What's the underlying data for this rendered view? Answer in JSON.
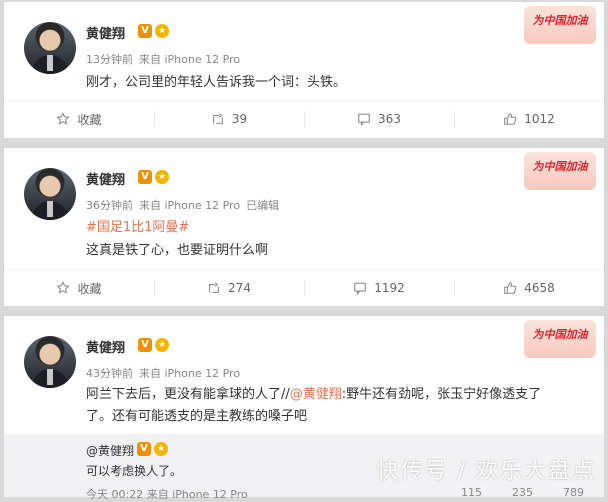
{
  "posts": [
    {
      "user": "黄健翔",
      "time": "13分钟前",
      "from": "来自 iPhone 12 Pro",
      "text": "刚才，公司里的年轻人告诉我一个词：头铁。",
      "favorite_label": "收藏",
      "reposts": "39",
      "comments": "363",
      "likes": "1012",
      "sticker": "为中国加油"
    },
    {
      "user": "黄健翔",
      "time": "36分钟前",
      "from": "来自 iPhone 12 Pro",
      "edited": "已编辑",
      "topic": "#国足1比1阿曼#",
      "text": "这真是铁了心，也要证明什么啊",
      "favorite_label": "收藏",
      "reposts": "274",
      "comments": "1192",
      "likes": "4658",
      "sticker": "为中国加油"
    },
    {
      "user": "黄健翔",
      "time": "43分钟前",
      "from": "来自 iPhone 12 Pro",
      "text_line1_a": "阿兰下去后，更没有能拿球的人了//",
      "mention": "@黄健翔",
      "text_line1_b": ":野牛还有劲呢，张玉宁好像透支了",
      "text_line2": "了。还有可能透支的是主教练的嗓子吧",
      "sticker": "为中国加油",
      "retweet": {
        "user": "@黄健翔",
        "text": "可以考虑换人了。",
        "time": "今天 00:22 来自 iPhone 12 Pro",
        "reposts": "115",
        "comments": "235",
        "likes": "789"
      }
    }
  ],
  "watermark": "快传号 / 欢乐大盘点",
  "icons": {
    "favorite": "star-icon",
    "repost": "repost-icon",
    "comment": "comment-icon",
    "like": "thumbs-up-icon"
  }
}
